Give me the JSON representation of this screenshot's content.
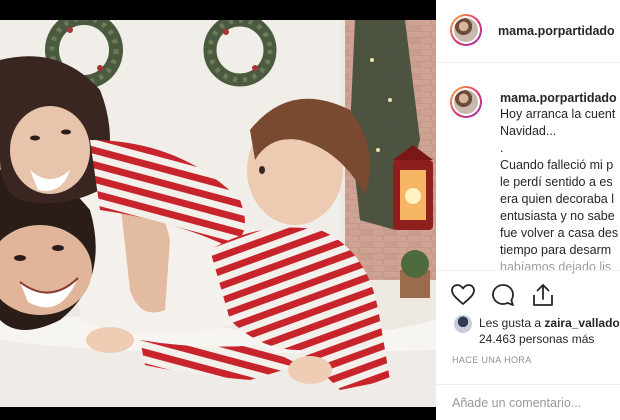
{
  "post": {
    "author": "mama.porpartidado",
    "caption_author": "mama.porpartidado",
    "caption_lines": [
      "Hoy arranca la cuent",
      "Navidad...",
      ".",
      "Cuando falleció mi p",
      "le perdí sentido a es",
      "era quien decoraba l",
      "entusiasta y no sabe",
      "fue volver a casa des",
      "tiempo para desarm",
      "habíamos dejado lis"
    ]
  },
  "likes": {
    "prefix": "Les gusta a ",
    "user": "zaira_vallado",
    "count": "24.463 personas más"
  },
  "timestamp": "HACE UNA HORA",
  "comment": {
    "placeholder": "Añade un comentario..."
  },
  "icons": {
    "like": "heart-icon",
    "comment": "comment-icon",
    "share": "share-icon"
  },
  "colors": {
    "stripe_red": "#c8242b",
    "text": "#262626",
    "muted": "#8e8e8e",
    "story_ring": "#e1306c"
  }
}
